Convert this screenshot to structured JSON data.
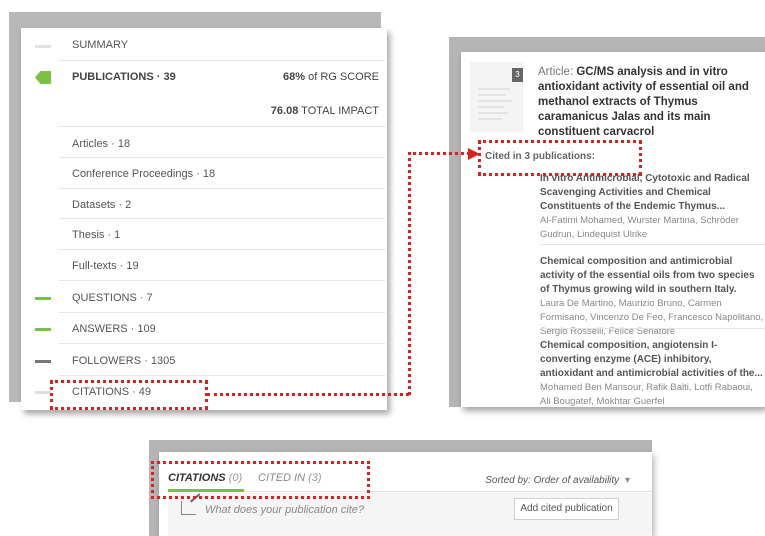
{
  "left_panel": {
    "summary": "SUMMARY",
    "publications": "PUBLICATIONS · 39",
    "rg_score_value": "68%",
    "rg_score_label": "of RG SCORE",
    "total_impact_value": "76.08",
    "total_impact_label": "TOTAL IMPACT",
    "subitems": [
      "Articles · 18",
      "Conference Proceedings · 18",
      "Datasets · 2",
      "Thesis · 1",
      "Full-texts · 19"
    ],
    "questions": "QUESTIONS · 7",
    "answers": "ANSWERS · 109",
    "followers": "FOLLOWERS · 1305",
    "citations": "CITATIONS · 49",
    "colors": {
      "green": "#7ac043",
      "grey": "#777777",
      "light": "#dddddd"
    }
  },
  "right_panel": {
    "number": "3",
    "article_prefix": "Article:",
    "article_title": "GC/MS analysis and in vitro antioxidant activity of essential oil and methanol extracts of Thymus caramanicus Jalas and its main constituent carvacrol",
    "cited_in": "Cited in 3 publications:",
    "publications": [
      {
        "title": "In vitro Antimicrobial, Cytotoxic and Radical Scavenging Activities and Chemical Constituents of the Endemic Thymus...",
        "authors": "Al-Fatimi Mohamed, Wurster Martina, Schröder Gudrun, Lindequist Ulrike"
      },
      {
        "title": "Chemical composition and antimicrobial activity of the essential oils from two species of Thymus growing wild in southern Italy.",
        "authors": "Laura De Martino, Maurizio Bruno, Carmen Formisano, Vincenzo De Feo, Francesco Napolitano, Sergio Rosselli, Felice Senatore"
      },
      {
        "title": "Chemical composition, angiotensin I-converting enzyme (ACE) inhibitory, antioxidant and antimicrobial activities of the...",
        "authors": "Mohamed Ben Mansour, Rafik Balti, Lotfi Rabaoui, Ali Bougatef, Mokhtar Guerfel"
      }
    ]
  },
  "bottom_panel": {
    "tab_citations": "CITATIONS",
    "tab_citations_count": "(0)",
    "tab_cited_in": "CITED IN",
    "tab_cited_in_count": "(3)",
    "sorted_by": "Sorted by: Order of availability",
    "placeholder": "What does your publication cite?",
    "add_button": "Add cited publication"
  },
  "annotation_color": "#d9221f"
}
